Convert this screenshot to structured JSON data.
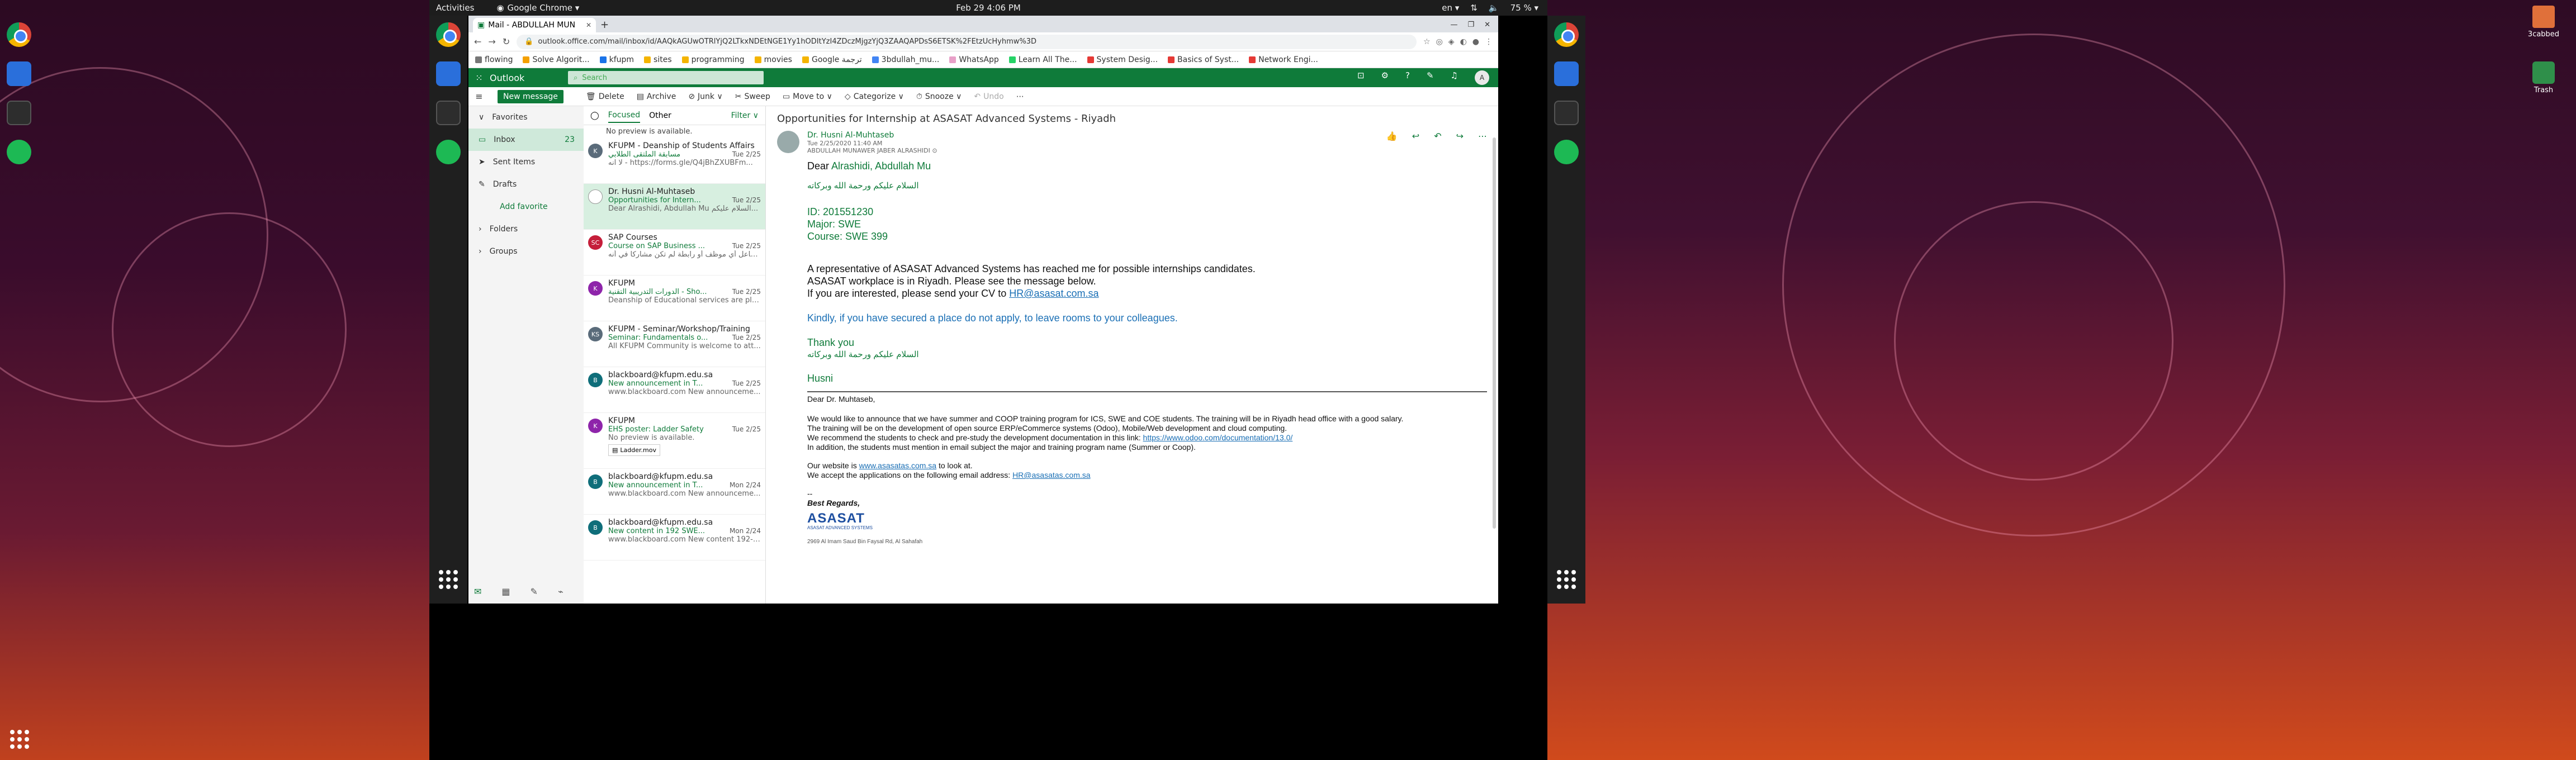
{
  "system": {
    "activities": "Activities",
    "app_name": "Google Chrome ▾",
    "clock": "Feb 29  4:06 PM",
    "lang": "en ▾",
    "battery": "75 % ▾"
  },
  "desktop": {
    "icons": [
      {
        "label": "3cabbed"
      },
      {
        "label": "Trash"
      }
    ]
  },
  "browser": {
    "tab_title": "Mail - ABDULLAH MUN",
    "url": "outlook.office.com/mail/inbox/id/AAQkAGUwOTRlYjQ2LTkxNDEtNGE1Yy1hODItYzI4ZDczMjgzYjQ3ZAAQAPDsS6ETSK%2FEtzUcHyhmw%3D",
    "bookmarks": [
      "flowing",
      "Solve Algorit...",
      "kfupm",
      "sites",
      "programming",
      "movies",
      "Google ترجمة",
      "3bdullah_mu...",
      "WhatsApp",
      "Learn All The...",
      "System Desig...",
      "Basics of Syst...",
      "Network Engi..."
    ]
  },
  "outlook": {
    "brand": "Outlook",
    "search_placeholder": "Search",
    "avatar_initial": "A",
    "new_message": "New message",
    "commands": [
      "Delete",
      "Archive",
      "Junk ∨",
      "Sweep",
      "Move to ∨",
      "Categorize ∨",
      "Snooze ∨",
      "Undo"
    ],
    "nav": {
      "favorites": "Favorites",
      "inbox": "Inbox",
      "inbox_count": "23",
      "sent": "Sent Items",
      "drafts": "Drafts",
      "add_favorite": "Add favorite",
      "folders": "Folders",
      "groups": "Groups"
    },
    "list": {
      "focused": "Focused",
      "other": "Other",
      "filter": "Filter ∨",
      "top_note": "No preview is available.",
      "messages": [
        {
          "initial": "K",
          "color": "#5a6b7a",
          "from": "KFUPM - Deanship of Students Affairs",
          "subject": "مسابقة الملتقى الطلابي",
          "date": "Tue 2/25",
          "preview": "لا آنه - https://forms.gle/Q4jBhZXUBFm..."
        },
        {
          "initial": "",
          "color": "#ffffff",
          "from": "Dr. Husni Al-Muhtaseb",
          "subject": "Opportunities for Intern...",
          "date": "Tue 2/25",
          "preview": "Dear Alrashidi, Abdullah Mu السلام عليكم..."
        },
        {
          "initial": "SC",
          "color": "#c51e3a",
          "from": "SAP Courses",
          "subject": "Course on SAP Business ...",
          "date": "Tue 2/25",
          "preview": "هنا لا تفاعل أي موظف أو رابطة لم تكن مشاركا في أنه ..."
        },
        {
          "initial": "K",
          "color": "#8e24aa",
          "from": "KFUPM",
          "subject": "الدورات التدريبية التقنية - Sho...",
          "date": "Tue 2/25",
          "preview": "Deanship of Educational services are ple..."
        },
        {
          "initial": "KS",
          "color": "#5a6b7a",
          "from": "KFUPM - Seminar/Workshop/Training",
          "subject": "Seminar: Fundamentals o...",
          "date": "Tue 2/25",
          "preview": "All KFUPM Community is welcome to att..."
        },
        {
          "initial": "B",
          "color": "#0f6e7a",
          "from": "blackboard@kfupm.edu.sa",
          "subject": "New announcement in T...",
          "date": "Tue 2/25",
          "preview": "www.blackboard.com New announceme..."
        },
        {
          "initial": "K",
          "color": "#8e24aa",
          "from": "KFUPM",
          "subject": "EHS poster: Ladder Safety",
          "date": "Tue 2/25",
          "preview": "No preview is available.",
          "attachment": "Ladder.mov"
        },
        {
          "initial": "B",
          "color": "#0f6e7a",
          "from": "blackboard@kfupm.edu.sa",
          "subject": "New announcement in T...",
          "date": "Mon 2/24",
          "preview": "www.blackboard.com New announceme..."
        },
        {
          "initial": "B",
          "color": "#0f6e7a",
          "from": "blackboard@kfupm.edu.sa",
          "subject": "New content in 192 SWE...",
          "date": "Mon 2/24",
          "preview": "www.blackboard.com New content 192-S..."
        }
      ]
    },
    "reading": {
      "subject": "Opportunities for Internship at ASASAT Advanced Systems - Riyadh",
      "sender": "Dr. Husni Al-Muhtaseb",
      "sent": "Tue 2/25/2020 11:40 AM",
      "to": "ABDULLAH MUNAWER JABER ALRASHIDI ⊙",
      "greeting_prefix": "Dear ",
      "greeting_name": "Alrashidi, Abdullah Mu",
      "salam": "السلام عليكم ورحمة الله وبركاته",
      "id_line": "ID:  201551230",
      "major_line": "Major: SWE",
      "course_line": "Course: SWE 399",
      "para1": "A representative of ASASAT Advanced Systems has reached me for possible internships candidates.",
      "para2": "ASASAT workplace is in Riyadh. Please see the message below.",
      "para3_prefix": "If you are interested, please send your CV to ",
      "email": "HR@asasat.com.sa",
      "kindly": "Kindly, if you have secured a place do not apply, to leave rooms to your colleagues.",
      "thanks": "Thank you",
      "salam2": "السلام عليكم ورحمة الله وبركاته",
      "sign": "Husni",
      "q_greeting": "Dear Dr. Muhtaseb,",
      "q1": "We would like to announce that we have summer and COOP training program for  ICS, SWE and COE students. The training will be in Riyadh head office with a good salary.",
      "q2": "The training will be on the development of open source ERP/eCommerce systems (Odoo), Mobile/Web development and cloud computing.",
      "q3_prefix": "We recommend the students to check and pre-study the development documentation in this link: ",
      "q3_link": "https://www.odoo.com/documentation/13.0/",
      "q4": "In addition, the students must mention in email subject the major and training program name (Summer or Coop).",
      "q5_prefix": "Our website is ",
      "q5_link": "www.asasatas.com.sa",
      "q5_suffix": " to look at.",
      "q6_prefix": "We accept the applications on the following email address: ",
      "q6_link": "HR@asasatas.com.sa",
      "q_dash": "--",
      "best": "Best Regards,",
      "logo": "ASASAT",
      "logo_sub": "ASASAT ADVANCED SYSTEMS",
      "address": "2969 Al Imam Saud Bin Faysal Rd, Al Sahafah"
    }
  }
}
